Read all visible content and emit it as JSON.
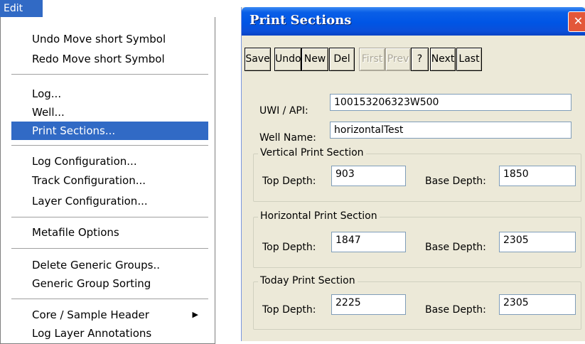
{
  "menu": {
    "title": "Edit",
    "items": [
      {
        "label": "Undo Move short Symbol"
      },
      {
        "label": "Redo Move short Symbol"
      },
      {
        "label": "Log..."
      },
      {
        "label": "Well..."
      },
      {
        "label": "Print Sections...",
        "selected": true
      },
      {
        "label": "Log Configuration..."
      },
      {
        "label": "Track Configuration..."
      },
      {
        "label": "Layer Configuration..."
      },
      {
        "label": "Metafile Options"
      },
      {
        "label": "Delete Generic Groups.."
      },
      {
        "label": "Generic Group Sorting"
      },
      {
        "label": "Core / Sample Header",
        "submenu": true,
        "arrow": "▶"
      },
      {
        "label": "Log Layer Annotations"
      }
    ]
  },
  "dialog": {
    "title": "Print Sections",
    "close_icon": "✕",
    "toolbar": {
      "save": "Save",
      "undo": "Undo",
      "new": "New",
      "del": "Del",
      "first": "First",
      "prev": "Prev",
      "help": "?",
      "next": "Next",
      "last": "Last"
    },
    "uwi_label": "UWI / API:",
    "uwi_value": "100153206323W500",
    "well_name_label": "Well Name:",
    "well_name_value": "horizontalTest",
    "sections": [
      {
        "title": "Vertical Print Section",
        "top_label": "Top Depth:",
        "top": "903",
        "base_label": "Base Depth:",
        "base": "1850"
      },
      {
        "title": "Horizontal Print Section",
        "top_label": "Top Depth:",
        "top": "1847",
        "base_label": "Base Depth:",
        "base": "2305"
      },
      {
        "title": "Today Print Section",
        "top_label": "Top Depth:",
        "top": "2225",
        "base_label": "Base Depth:",
        "base": "2305"
      }
    ]
  },
  "colors": {
    "selection": "#316ac5",
    "dialog_bg": "#ece9d8",
    "title_bar": "#0055e5",
    "close": "#e3573a"
  }
}
